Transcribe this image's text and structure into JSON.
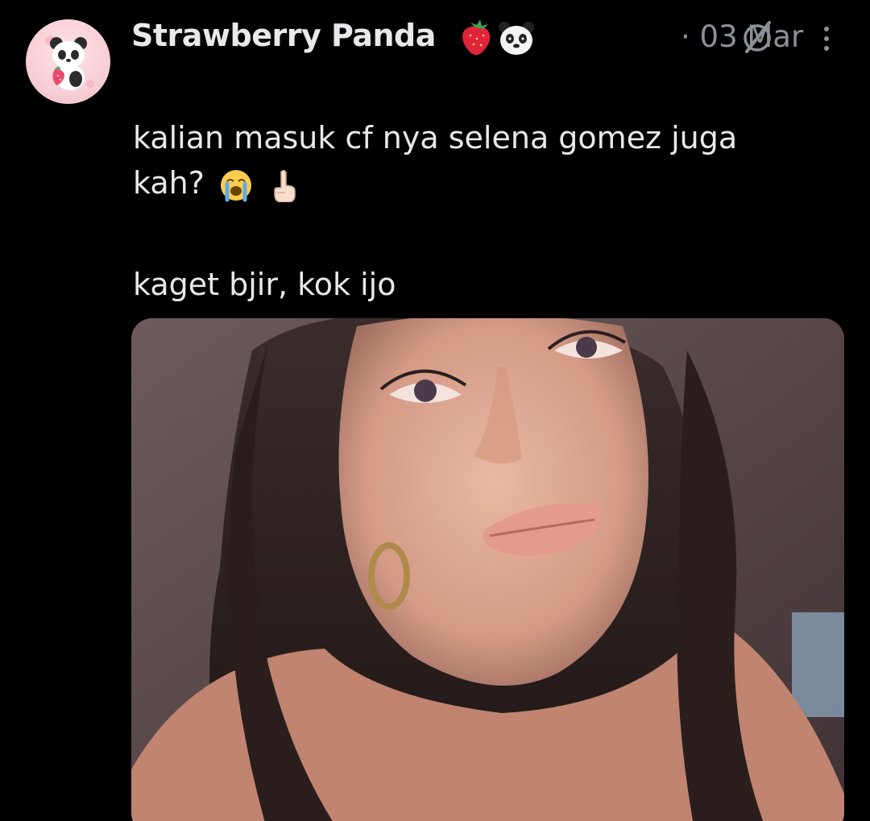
{
  "author": {
    "display_name": "Strawberry Panda",
    "name_emojis": [
      "strawberry-icon",
      "panda-icon"
    ],
    "timestamp": "03 Mar",
    "separator": "·"
  },
  "tweet": {
    "line1": "kalian masuk cf nya selena gomez juga",
    "line2": "kah?",
    "line2_emojis": [
      "crying-face-icon",
      "index-pointing-up-icon"
    ],
    "line3": "kaget bjir, kok ijo"
  },
  "icons": {
    "grok": "grok-icon",
    "more": "more-vertical-icon"
  },
  "colors": {
    "background": "#000000",
    "primary_text": "#e7e9ea",
    "secondary_text": "#8b9196"
  }
}
